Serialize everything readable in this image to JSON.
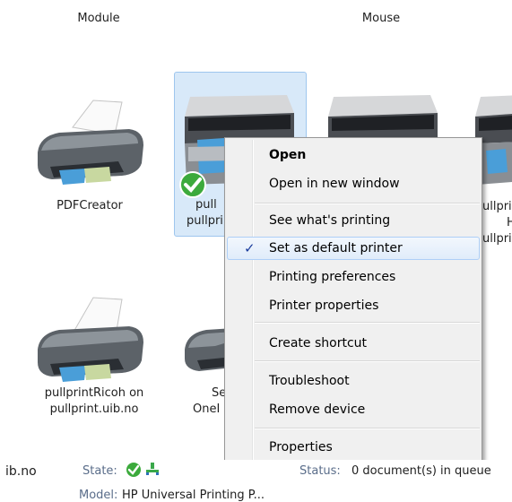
{
  "top_labels": {
    "left": "Module",
    "right": "Mouse"
  },
  "printers": [
    {
      "name": "PDFCreator"
    },
    {
      "name_line1": "pull",
      "name_line2": "pullpri"
    },
    {
      "name_line1": "",
      "name_line2": ""
    },
    {
      "name_line1": "ullpri",
      "name_line2": "H",
      "name_line3": "ullpri"
    },
    {
      "name_line1": "pullprintRicoh on",
      "name_line2": "pullprint.uib.no"
    },
    {
      "name_line1": "Se",
      "name_line2": "OneI"
    }
  ],
  "context_menu": {
    "open": "Open",
    "open_new_window": "Open in new window",
    "see_printing": "See what's printing",
    "set_default": "Set as default printer",
    "printing_prefs": "Printing preferences",
    "printer_props": "Printer properties",
    "create_shortcut": "Create shortcut",
    "troubleshoot": "Troubleshoot",
    "remove_device": "Remove device",
    "properties": "Properties",
    "check_glyph": "✓"
  },
  "status_bar": {
    "name_fragment": "ib.no",
    "state_label": "State:",
    "status_label": "Status:",
    "status_value": "0 document(s) in queue",
    "model_label": "Model:",
    "model_value": "HP Universal Printing P..."
  },
  "colors": {
    "selection": "#d8e9f9",
    "menu_bg": "#f0f0f0",
    "highlight_border": "#aecff7",
    "check": "#1a3c9c",
    "default_badge": "#3caa3c"
  }
}
